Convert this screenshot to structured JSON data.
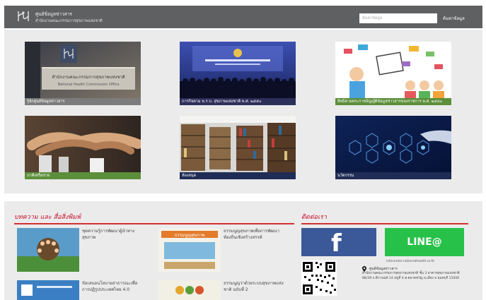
{
  "header": {
    "org_line1": "ศูนย์ข้อมูลข่าวสาร",
    "org_line2": "สำนักงานคณะกรรมการสุขภาพแห่งชาติ",
    "search_placeholder": "ค้นหาข้อมูล",
    "search_link": "ค้นหาข้อมูล"
  },
  "tiles": [
    {
      "caption": "รู้จักศูนย์ข้อมูลข่าวสาร",
      "sign_thai": "สำนักงานคณะกรรมการสุขภาพแห่งชาติ",
      "sign_en": "National Health Commission Office"
    },
    {
      "caption": "ภารกิจตาม พ.ร.บ. สุขภาพแห่งชาติ พ.ศ. ๒๕๕๐"
    },
    {
      "caption": "สิทธิตามพระราชบัญญัติข้อมูลข่าวสารของราชการ พ.ศ. ๒๕๔๐"
    },
    {
      "caption": "ภาคีเครือข่าย"
    },
    {
      "caption": "ห้องสมุด"
    },
    {
      "caption": "นวัตกรรม"
    }
  ],
  "news": {
    "title": "บทความ และ สื่อสิ่งพิมพ์",
    "items": [
      {
        "text": "ชุดความรู้การพัฒนาผู้นำทางสุขภาพ"
      },
      {
        "text": "ธรรมนูญสุขภาพเพื่อการพัฒนาท้องถิ่นเชิงสร้างสรรค์",
        "thumb_label": "ธรรมนูญสุขภาพ"
      },
      {
        "text": "ข้อเสนอนโยบายสาธารณะเพื่อการปฏิรูปประเทศไทย 4.0"
      },
      {
        "text": "ธรรมนูญว่าด้วยระบบสุขภาพแห่งชาติ ฉบับที่ 2"
      }
    ]
  },
  "contact": {
    "title": "ติดต่อเรา",
    "facebook_glyph": "f",
    "line_label": "LINE@",
    "email": "infocenter.nationalhealth.or.th",
    "addr_title": "ศูนย์ข้อมูลข่าวสาร",
    "addr": "สำนักงานคณะกรรมการสุขภาพแห่งชาติ ชั้น 3 อาคารสุขภาพแห่งชาติ 88/39 ถ.ติวานนท์ 14 หมู่ที่ 4 ต.ตลาดขวัญ อ.เมือง จ.นนทบุรี 11000"
  },
  "colors": {
    "header_bg": "#5f6062",
    "accent_red": "#d32f2f",
    "facebook": "#3b5998",
    "line": "#27c14a"
  }
}
